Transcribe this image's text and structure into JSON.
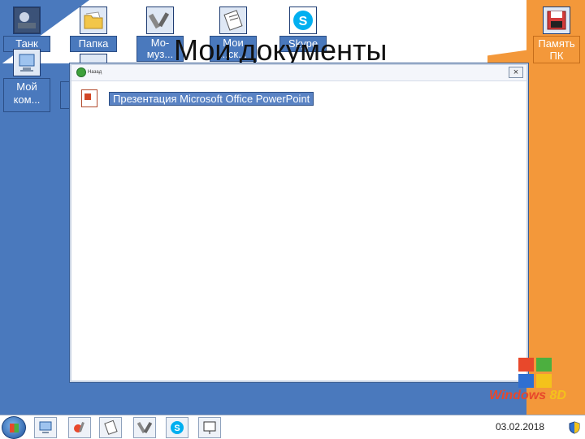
{
  "slide": {
    "title": "Мои документы"
  },
  "desktop_icons": {
    "tank": "Танк",
    "folder": "Папка",
    "music_line1": "Мо-",
    "music_line2": "муз...",
    "docs_line1": "Мои",
    "docs_line2": "...ск...",
    "skype": "Skype",
    "my_computer_line1": "Мой",
    "my_computer_line2": "ком...",
    "memory_line1": "Память",
    "memory_line2": "ПК"
  },
  "window": {
    "back_label": "Назад",
    "close_glyph": "×",
    "file_label": "Презентация Microsoft Office PowerPoint"
  },
  "branding": {
    "logo_text": "Windows",
    "logo_version": "8D"
  },
  "taskbar": {
    "date": "03.02.2018"
  },
  "colors": {
    "desktop_blue": "#4a79bd",
    "accent_orange": "#f3983a",
    "skype_blue": "#00aff0"
  }
}
